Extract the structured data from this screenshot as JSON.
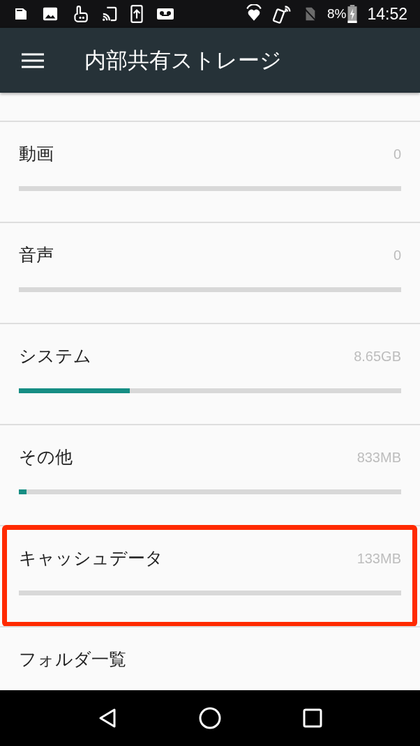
{
  "status_bar": {
    "battery": "8%",
    "time": "14:52"
  },
  "app_bar": {
    "title": "内部共有ストレージ"
  },
  "storage_items": [
    {
      "kind": "usage",
      "label": "動画",
      "value": "0",
      "highlighted": false
    },
    {
      "kind": "usage",
      "label": "音声",
      "value": "0",
      "highlighted": false
    },
    {
      "kind": "usage",
      "label": "システム",
      "value": "8.65GB",
      "level": 0.29,
      "highlighted": false
    },
    {
      "kind": "usage",
      "label": "その他",
      "value": "833MB",
      "level": 0.02,
      "highlighted": false
    },
    {
      "kind": "usage",
      "label": "キャッシュデータ",
      "value": "133MB",
      "highlighted": true
    },
    {
      "kind": "link",
      "label": "フォルダ一覧",
      "highlighted": false
    }
  ]
}
